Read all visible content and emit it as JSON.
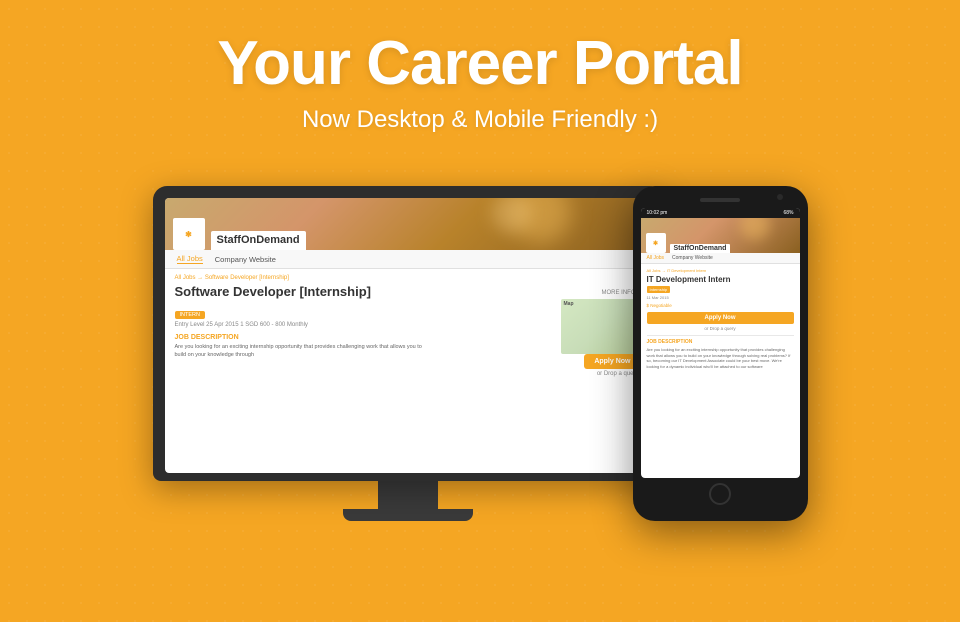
{
  "hero": {
    "title": "Your Career Portal",
    "subtitle": "Now Desktop & Mobile Friendly :)",
    "bg_color": "#F5A623"
  },
  "desktop_screen": {
    "company": "StaffOnDemand",
    "nav": [
      "All Jobs",
      "Company Website"
    ],
    "breadcrumb": "All Jobs → Software Developer [Internship]",
    "job_title": "Software Developer [Internship]",
    "badge": "INTERN",
    "meta": "Entry Level   25 Apr 2015   1   SGD 600 - 800 Monthly",
    "apply_btn": "Apply Now",
    "drop_query": "or Drop a query",
    "section_title": "JOB DESCRIPTION",
    "desc": "Are you looking for an exciting internship opportunity that provides challenging work that allows you to build on your knowledge through",
    "more_info": "MORE INFO",
    "map_label": "Map"
  },
  "mobile_screen": {
    "status_time": "10:02 pm",
    "status_battery": "68%",
    "company": "StaffOnDemand",
    "nav": [
      "All Jobs",
      "Company Website"
    ],
    "breadcrumb": "All Jobs → IT Development Intern",
    "job_title": "IT Development Intern",
    "badge1": "Internship",
    "meta": "11 Mar 2015",
    "salary": "$ Negotiable",
    "apply_btn": "Apply Now",
    "drop_query": "or Drop a query",
    "section_title": "JOB DESCRIPTION",
    "desc": "Are you looking for an exciting internship opportunity that provides challenging work that allows you to build on your knowledge through solving real problems? If so, becoming our IT Development Associate could be your best move. We're looking for a dynamic individual who'll be attached to our software"
  }
}
